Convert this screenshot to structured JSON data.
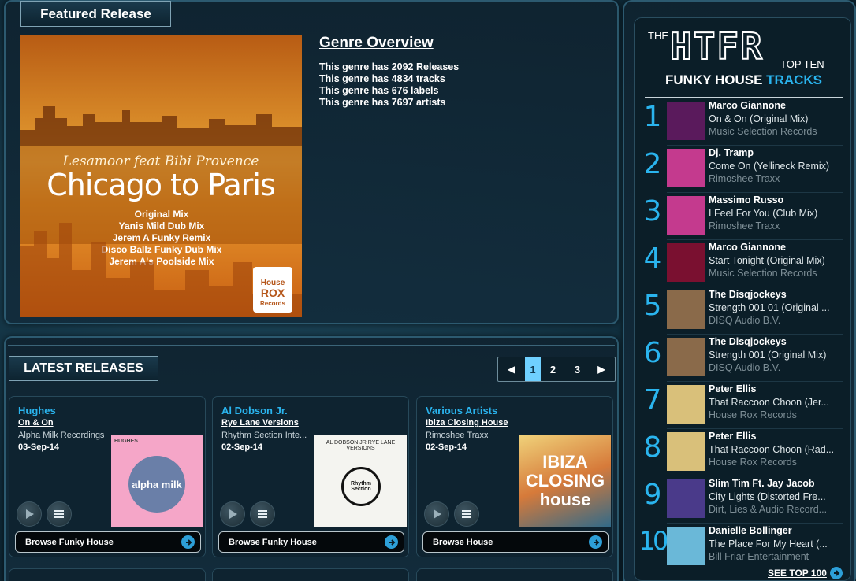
{
  "featured": {
    "tab_label": "Featured Release",
    "cover": {
      "artist": "Lesamoor feat Bibi Provence",
      "title": "Chicago to Paris",
      "mixes": [
        "Original Mix",
        "Yanis Mild Dub Mix",
        "Jerem A Funky Remix",
        "Disco Ballz Funky Dub Mix",
        "Jerem A's Poolside Mix"
      ],
      "logo": [
        "House",
        "ROX",
        "Records"
      ]
    },
    "genre_heading": "Genre Overview",
    "genre_lines": [
      "This genre has 2092 Releases",
      "This genre has 4834 tracks",
      "This genre has 676 labels",
      "This genre has 7697 artists"
    ]
  },
  "latest": {
    "tab_label": "LATEST RELEASES",
    "pager": {
      "prev": "◀",
      "pages": [
        "1",
        "2",
        "3"
      ],
      "current": "1",
      "next": "▶"
    },
    "cards": [
      {
        "artist": "Hughes",
        "release": "On & On",
        "label": "Alpha Milk Recordings",
        "date": "03-Sep-14",
        "browse": "Browse Funky House",
        "art_text": "alpha milk",
        "art_caption": "HUGHES"
      },
      {
        "artist": "Al Dobson Jr.",
        "release": "Rye Lane Versions",
        "label": "Rhythm Section Inte...",
        "date": "02-Sep-14",
        "browse": "Browse Funky House",
        "art_text": "Rhythm Section",
        "art_caption": "AL DOBSON JR RYE LANE VERSIONS"
      },
      {
        "artist": "Various Artists",
        "release": "Ibiza Closing House",
        "label": "Rimoshee Traxx",
        "date": "02-Sep-14",
        "browse": "Browse House",
        "art_text": "IBIZA CLOSING house",
        "art_caption": ""
      }
    ]
  },
  "topten": {
    "logo_the": "THE",
    "logo_main": "HTFR",
    "logo_topten": "TOP TEN",
    "heading_a": "FUNKY HOUSE",
    "heading_b": "TRACKS",
    "items": [
      {
        "n": "1",
        "artist": "Marco Giannone",
        "title": "On & On (Original Mix)",
        "label": "Music Selection Records",
        "color": "#5a1a5c"
      },
      {
        "n": "2",
        "artist": "Dj. Tramp",
        "title": "Come On (Yellineck Remix)",
        "label": "Rimoshee Traxx",
        "color": "#c43a8e"
      },
      {
        "n": "3",
        "artist": "Massimo Russo",
        "title": "I Feel For You (Club Mix)",
        "label": "Rimoshee Traxx",
        "color": "#c43a8e"
      },
      {
        "n": "4",
        "artist": "Marco Giannone",
        "title": "Start Tonight (Original Mix)",
        "label": "Music Selection Records",
        "color": "#7a1030"
      },
      {
        "n": "5",
        "artist": "The Disqjockeys",
        "title": "Strength 001 01 (Original ...",
        "label": "DISQ Audio B.V.",
        "color": "#8a6a4a"
      },
      {
        "n": "6",
        "artist": "The Disqjockeys",
        "title": "Strength 001 (Original Mix)",
        "label": "DISQ Audio B.V.",
        "color": "#8a6a4a"
      },
      {
        "n": "7",
        "artist": "Peter Ellis",
        "title": "That Raccoon Choon (Jer...",
        "label": "House Rox Records",
        "color": "#d9c07a"
      },
      {
        "n": "8",
        "artist": "Peter Ellis",
        "title": "That Raccoon Choon (Rad...",
        "label": "House Rox Records",
        "color": "#d9c07a"
      },
      {
        "n": "9",
        "artist": "Slim Tim Ft. Jay Jacob",
        "title": "City Lights (Distorted Fre...",
        "label": "Dirt, Lies & Audio Record...",
        "color": "#4a3a8a"
      },
      {
        "n": "10",
        "artist": "Danielle Bollinger",
        "title": "The Place For My Heart (...",
        "label": "Bill Friar Entertainment",
        "color": "#6ab8d8"
      }
    ],
    "see_more": "SEE TOP 100"
  }
}
